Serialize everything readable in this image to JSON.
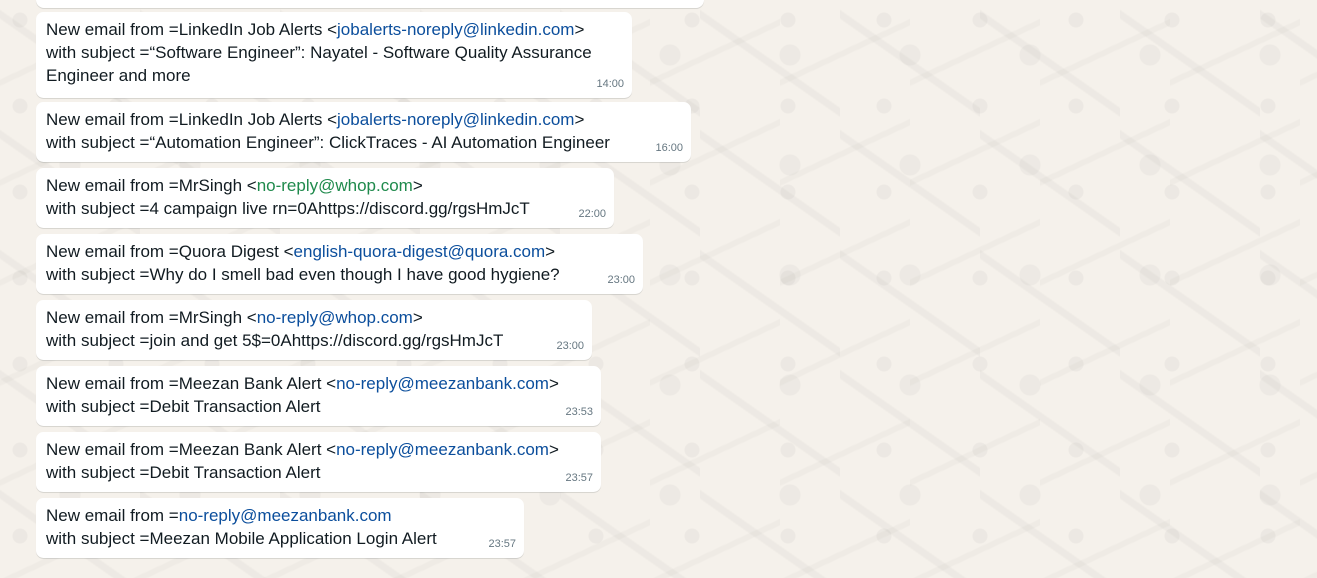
{
  "messages": [
    {
      "prefix": "New email from =LinkedIn Job Alerts <",
      "email": "jobalerts-noreply@linkedin.com",
      "suffix": ">",
      "line2": "with subject =“Software Engineer”: Nayatel - Software Quality Assurance",
      "line3": "Engineer and more",
      "time": "14:00"
    },
    {
      "prefix": "New email from =LinkedIn Job Alerts <",
      "email": "jobalerts-noreply@linkedin.com",
      "suffix": ">",
      "line2": "with subject =“Automation Engineer”: ClickTraces - AI Automation Engineer",
      "time": "16:00"
    },
    {
      "prefix": "New email from =MrSingh <",
      "email": "no-reply@whop.com",
      "suffix": ">",
      "line2": "with subject =4 campaign live rn=0Ahttps://discord.gg/rgsHmJcT",
      "time": "22:00"
    },
    {
      "prefix": "New email from =Quora Digest <",
      "email": "english-quora-digest@quora.com",
      "suffix": ">",
      "line2": "with subject =Why do I smell bad even though I have good hygiene?",
      "time": "23:00"
    },
    {
      "prefix": "New email from =MrSingh <",
      "email": "no-reply@whop.com",
      "suffix": ">",
      "line2": "with subject =join and get 5$=0Ahttps://discord.gg/rgsHmJcT",
      "time": "23:00"
    },
    {
      "prefix": "New email from =Meezan Bank Alert <",
      "email": "no-reply@meezanbank.com",
      "suffix": ">",
      "line2": "with subject =Debit Transaction Alert",
      "time": "23:53"
    },
    {
      "prefix": "New email from =Meezan Bank Alert <",
      "email": "no-reply@meezanbank.com",
      "suffix": ">",
      "line2": "with subject =Debit Transaction Alert",
      "time": "23:57"
    },
    {
      "prefix": "New email from =",
      "email": "no-reply@meezanbank.com",
      "suffix": "",
      "line2": "with subject =Meezan Mobile Application Login Alert",
      "time": "23:57"
    }
  ],
  "colors": {
    "wallpaper": "#f5f1eb",
    "bubble": "#ffffff",
    "text": "#111b21",
    "link": "#0b4e9c",
    "link_visited_green": "#1f8a4c",
    "timestamp": "#667781"
  },
  "icons": {
    "wallpaper_pattern": "doodle-pattern"
  }
}
